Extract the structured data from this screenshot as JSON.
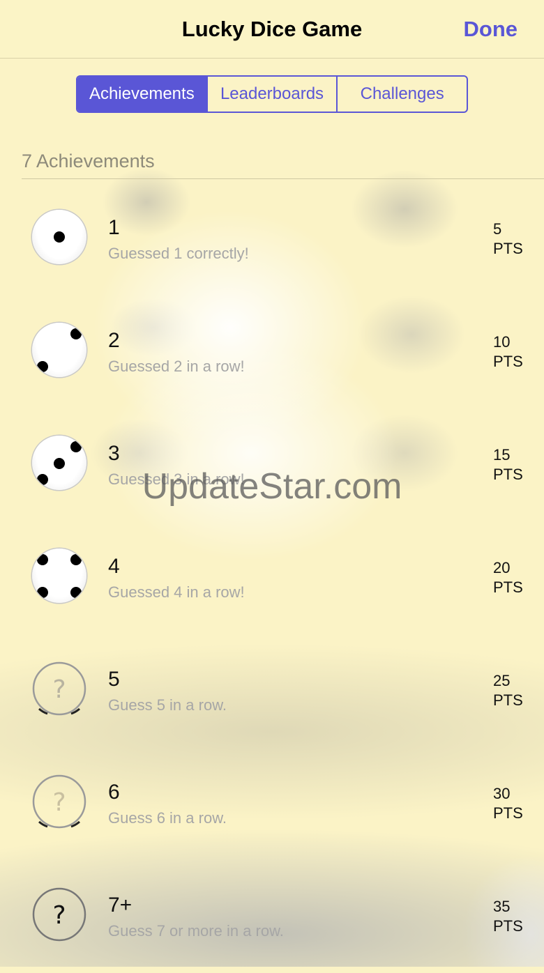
{
  "navbar": {
    "title": "Lucky Dice Game",
    "done_label": "Done"
  },
  "tabs": [
    {
      "label": "Achievements",
      "active": true
    },
    {
      "label": "Leaderboards",
      "active": false
    },
    {
      "label": "Challenges",
      "active": false
    }
  ],
  "section_header": "7 Achievements",
  "achievements": [
    {
      "title": "1",
      "description": "Guessed 1 correctly!",
      "points": "5",
      "unit": "PTS",
      "icon": "die-one-icon"
    },
    {
      "title": "2",
      "description": "Guessed 2 in a row!",
      "points": "10",
      "unit": "PTS",
      "icon": "die-two-icon"
    },
    {
      "title": "3",
      "description": "Guessed 3 in a row!",
      "points": "15",
      "unit": "PTS",
      "icon": "die-three-icon"
    },
    {
      "title": "4",
      "description": "Guessed 4 in a row!",
      "points": "20",
      "unit": "PTS",
      "icon": "die-four-icon"
    },
    {
      "title": "5",
      "description": "Guess 5 in a row.",
      "points": "25",
      "unit": "PTS",
      "icon": "locked-question-icon"
    },
    {
      "title": "6",
      "description": "Guess 6 in a row.",
      "points": "30",
      "unit": "PTS",
      "icon": "locked-question-icon"
    },
    {
      "title": "7+",
      "description": "Guess 7 or more in a row.",
      "points": "35",
      "unit": "PTS",
      "icon": "locked-question-icon"
    }
  ],
  "watermark": "UpdateStar.com",
  "colors": {
    "accent": "#5a56d6",
    "background": "#fbf3c6"
  }
}
